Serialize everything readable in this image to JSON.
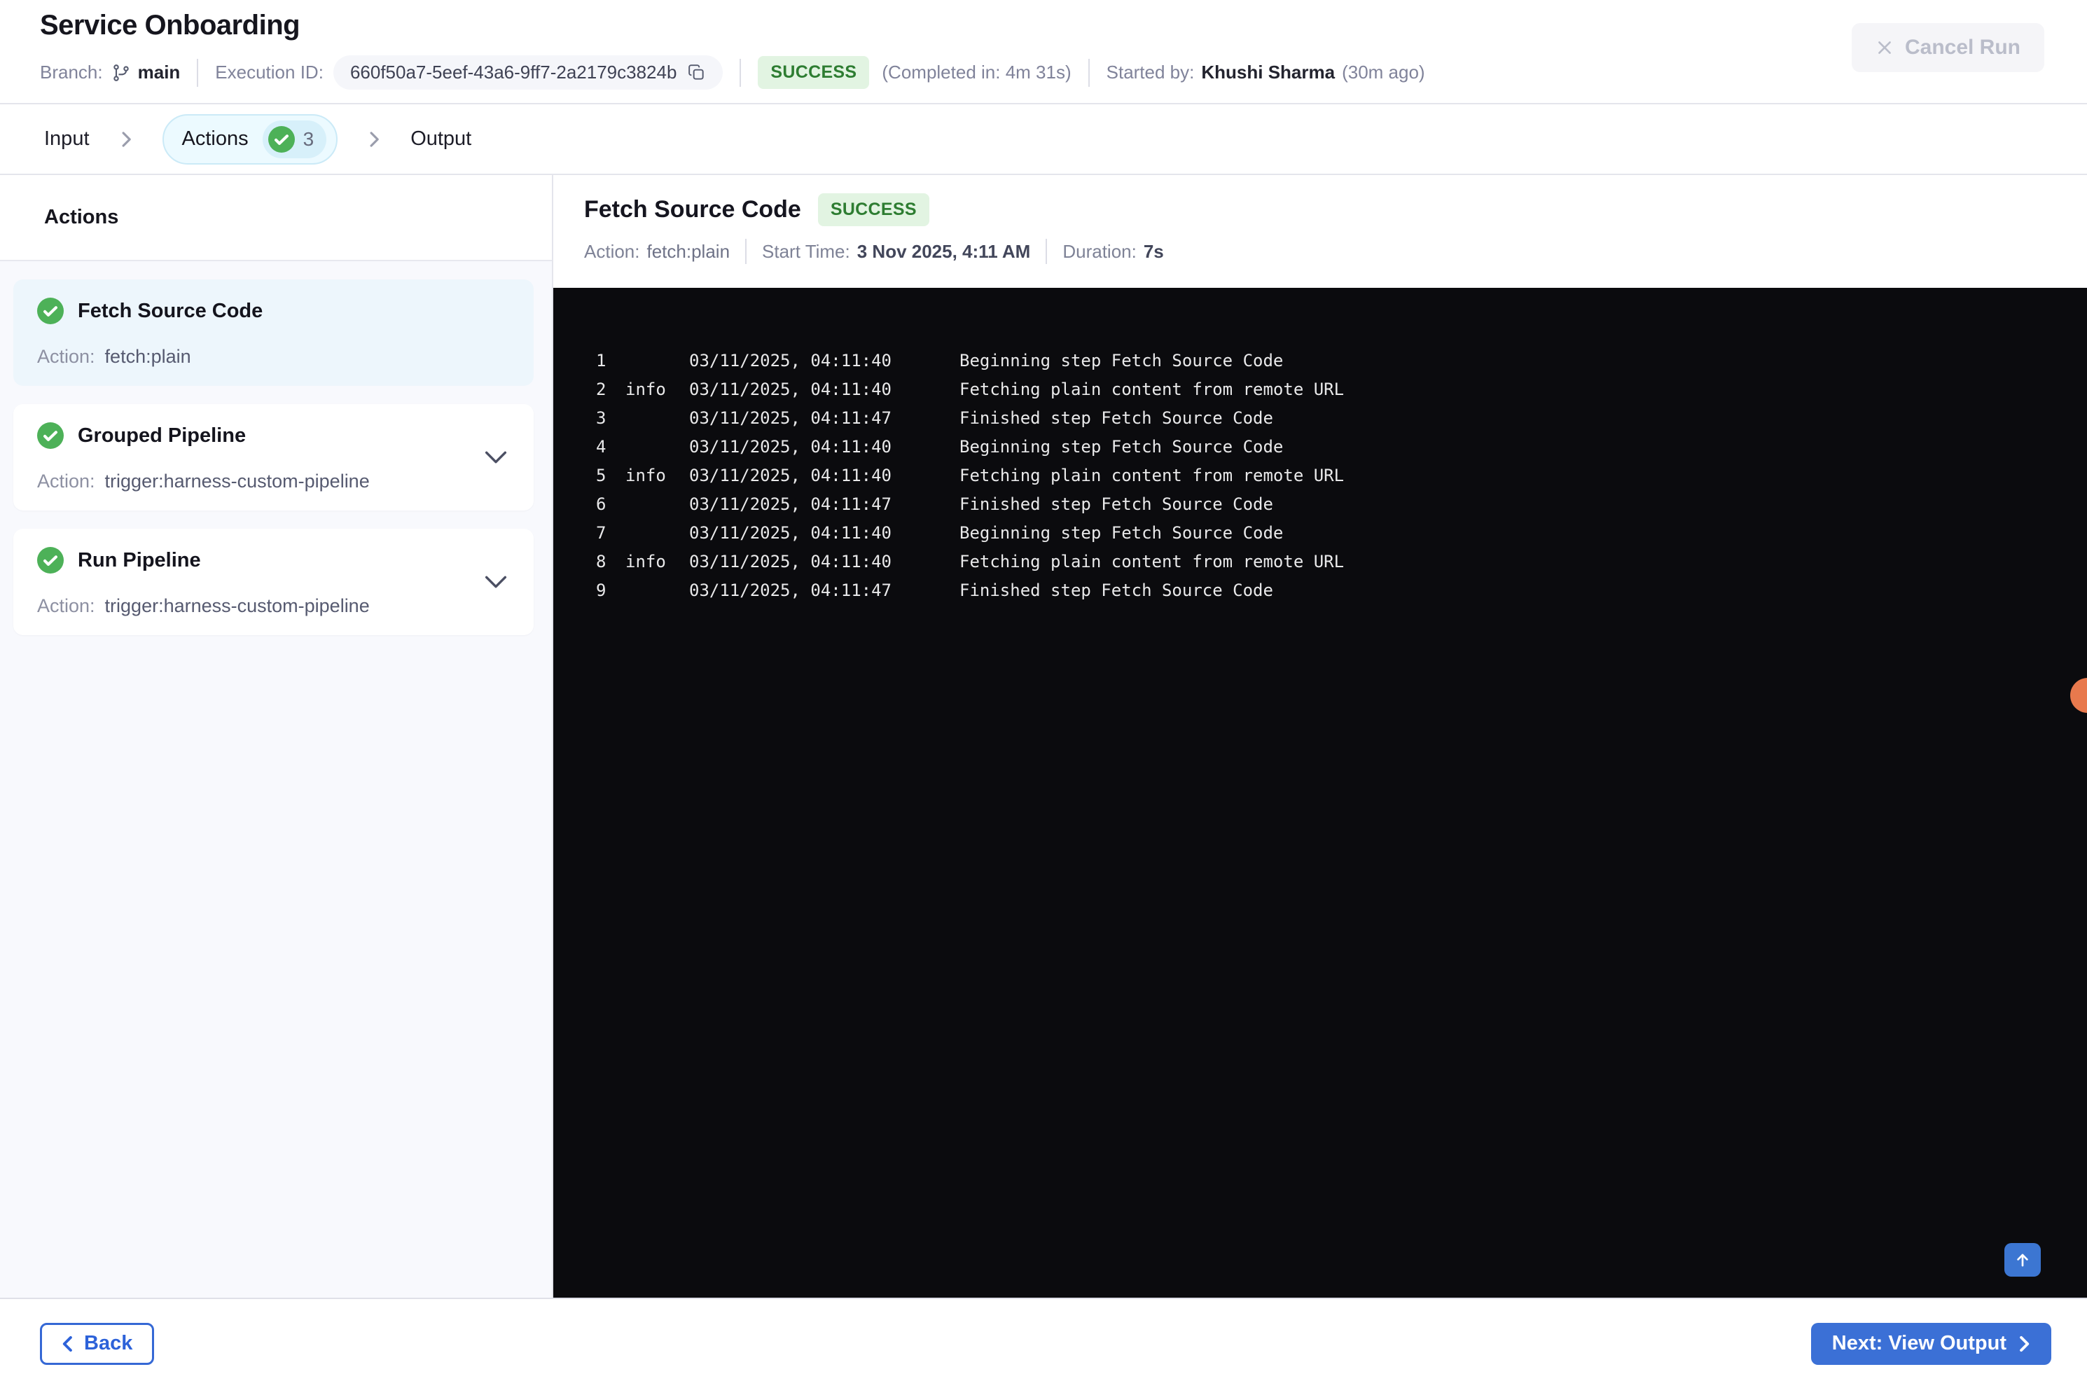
{
  "header": {
    "title": "Service Onboarding",
    "branch_label": "Branch:",
    "branch_value": "main",
    "execution_id_label": "Execution ID:",
    "execution_id": "660f50a7-5eef-43a6-9ff7-2a2179c3824b",
    "status": "SUCCESS",
    "completed_in": "(Completed in: 4m 31s)",
    "started_by_label": "Started by:",
    "started_by_name": "Khushi Sharma",
    "started_ago": "(30m ago)",
    "cancel_button": "Cancel Run"
  },
  "tabs": {
    "input": "Input",
    "actions": "Actions",
    "actions_count": "3",
    "output": "Output"
  },
  "sidebar": {
    "heading": "Actions",
    "items": [
      {
        "title": "Fetch Source Code",
        "action_label": "Action:",
        "action": "fetch:plain",
        "selected": true,
        "has_chevron": false
      },
      {
        "title": "Grouped Pipeline",
        "action_label": "Action:",
        "action": "trigger:harness-custom-pipeline",
        "selected": false,
        "has_chevron": true
      },
      {
        "title": "Run Pipeline",
        "action_label": "Action:",
        "action": "trigger:harness-custom-pipeline",
        "selected": false,
        "has_chevron": true
      }
    ]
  },
  "detail": {
    "title": "Fetch Source Code",
    "status": "SUCCESS",
    "action_label": "Action:",
    "action_value": "fetch:plain",
    "start_label": "Start Time:",
    "start_value": "3 Nov 2025, 4:11 AM",
    "duration_label": "Duration:",
    "duration_value": "7s"
  },
  "log": {
    "lines": [
      {
        "num": "1",
        "level": "",
        "time": "03/11/2025, 04:11:40",
        "msg": "Beginning step Fetch Source Code"
      },
      {
        "num": "2",
        "level": "info",
        "time": "03/11/2025, 04:11:40",
        "msg": "Fetching plain content from remote URL"
      },
      {
        "num": "3",
        "level": "",
        "time": "03/11/2025, 04:11:47",
        "msg": "Finished step Fetch Source Code"
      },
      {
        "num": "4",
        "level": "",
        "time": "03/11/2025, 04:11:40",
        "msg": "Beginning step Fetch Source Code"
      },
      {
        "num": "5",
        "level": "info",
        "time": "03/11/2025, 04:11:40",
        "msg": "Fetching plain content from remote URL"
      },
      {
        "num": "6",
        "level": "",
        "time": "03/11/2025, 04:11:47",
        "msg": "Finished step Fetch Source Code"
      },
      {
        "num": "7",
        "level": "",
        "time": "03/11/2025, 04:11:40",
        "msg": "Beginning step Fetch Source Code"
      },
      {
        "num": "8",
        "level": "info",
        "time": "03/11/2025, 04:11:40",
        "msg": "Fetching plain content from remote URL"
      },
      {
        "num": "9",
        "level": "",
        "time": "03/11/2025, 04:11:47",
        "msg": "Finished step Fetch Source Code"
      }
    ]
  },
  "footer": {
    "back": "Back",
    "next": "Next: View Output"
  },
  "colors": {
    "accent_blue": "#3b70d6",
    "success_badge_bg": "#e2f4e2",
    "success_badge_text": "#2e7d32",
    "check_green": "#4db158",
    "console_bg": "#0b0b0e",
    "active_tab_bg": "#ecfaff",
    "active_tab_border": "#cbeaf7",
    "selected_card_bg": "#edf6fc",
    "floating_dot": "#e8794d"
  }
}
